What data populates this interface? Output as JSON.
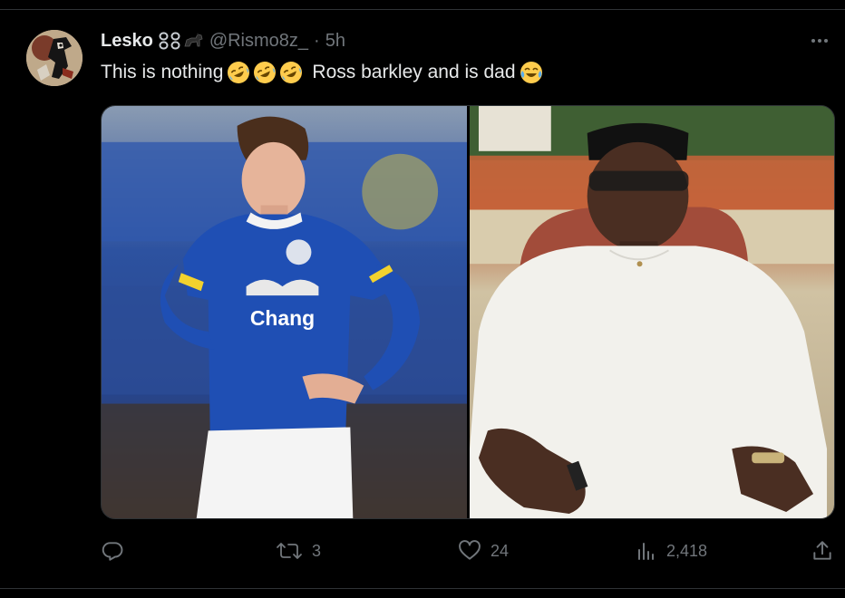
{
  "tweet": {
    "display_name": "Lesko",
    "handle": "@Rismo8z_",
    "separator": "·",
    "timestamp": "5h",
    "text_before": "This is nothing",
    "text_middle": "Ross barkley and is dad",
    "emojis": [
      "rolling-on-floor-laughing",
      "rolling-on-floor-laughing",
      "rolling-on-floor-laughing",
      "face-with-tears-of-joy"
    ],
    "badge_icons": [
      "chain-link-icon",
      "chain-link-icon",
      "horse-icon"
    ],
    "media": {
      "left_image": "footballer-in-blue-everton-kit",
      "right_image": "elderly-man-in-white-kaftan-and-black-cap",
      "kit_sponsor": "Chang"
    }
  },
  "actions": {
    "reply_count": "",
    "retweet_count": "3",
    "like_count": "24",
    "views_count": "2,418"
  },
  "colors": {
    "background": "#000000",
    "text_primary": "#e7e9ea",
    "text_secondary": "#71767b",
    "divider": "#2f3336"
  }
}
